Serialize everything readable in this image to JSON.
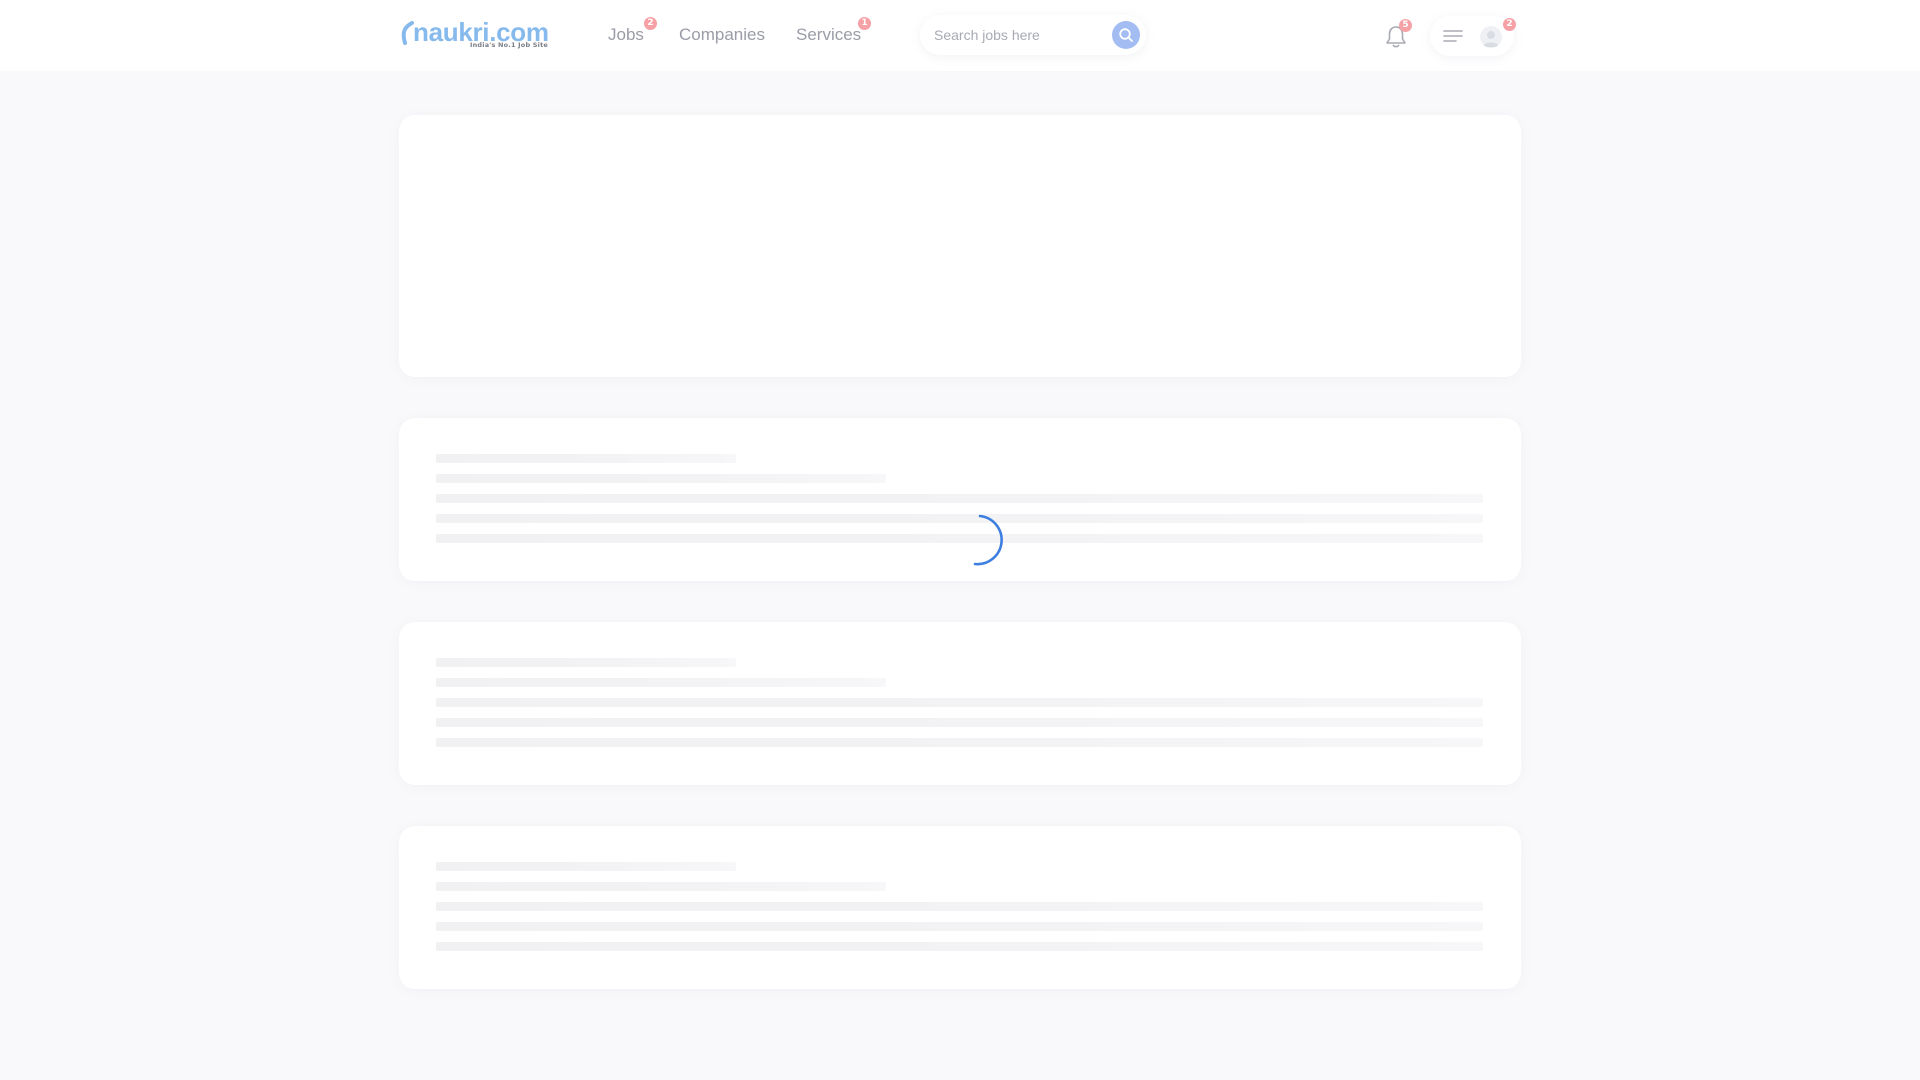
{
  "header": {
    "logo": {
      "wordmark": "naukri.com",
      "tagline": "India's No.1 Job Site",
      "brand_color": "#86b9ec"
    },
    "nav": [
      {
        "label": "Jobs",
        "badge": "2"
      },
      {
        "label": "Companies"
      },
      {
        "label": "Services",
        "badge": "1"
      }
    ],
    "search": {
      "placeholder": "Search jobs here",
      "value": "",
      "icon": "search-icon"
    },
    "notifications": {
      "icon": "bell-icon",
      "badge": "5"
    },
    "profile": {
      "menu_icon": "hamburger-icon",
      "avatar_icon": "user-avatar-icon",
      "badge": "2"
    }
  },
  "content": {
    "state": "loading",
    "spinner_color": "#3d7fe0",
    "skeleton_color": "#f1f1f3"
  }
}
